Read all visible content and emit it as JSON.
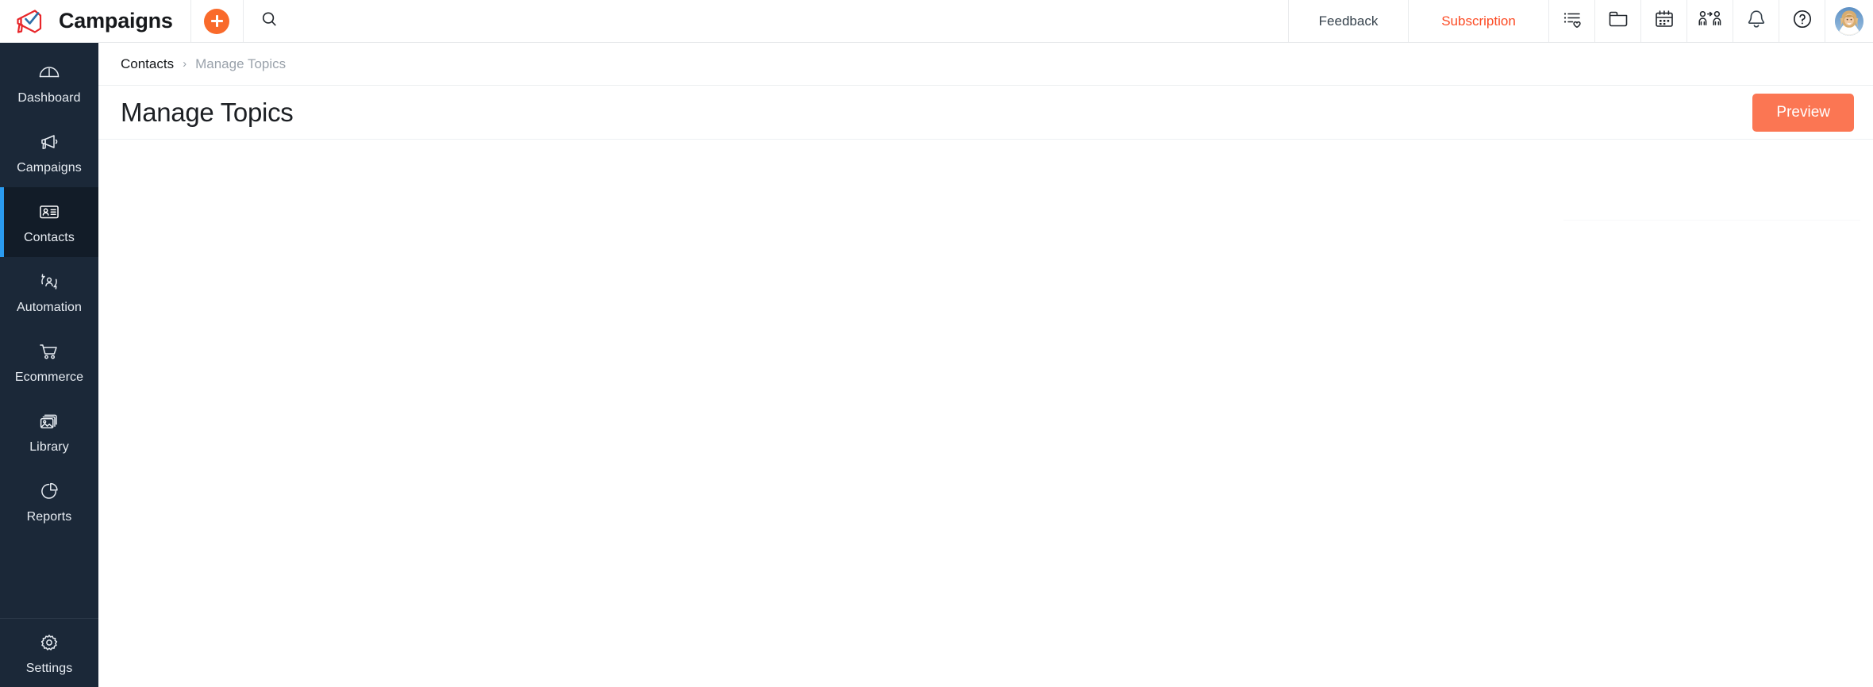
{
  "app": {
    "brand_title": "Campaigns",
    "logo_icon": "megaphone-logo-icon"
  },
  "header": {
    "add_button_icon": "plus-icon",
    "search_icon": "search-icon",
    "feedback_label": "Feedback",
    "subscription_label": "Subscription",
    "subscription_color": "#fc4b24",
    "accent_color": "#f96a2b",
    "icons": [
      {
        "name": "list-heart-icon",
        "title": "Favourite lists"
      },
      {
        "name": "folder-icon",
        "title": "Folders"
      },
      {
        "name": "calendar-icon",
        "title": "Calendar"
      },
      {
        "name": "invite-users-icon",
        "title": "Invite users"
      },
      {
        "name": "bell-icon",
        "title": "Notifications"
      },
      {
        "name": "help-circle-icon",
        "title": "Help"
      }
    ],
    "avatar": {
      "name": "user-avatar",
      "alt": "User profile photo"
    }
  },
  "sidebar": {
    "background": "#1b2838",
    "active_indicator_color": "#2a9bf0",
    "items": [
      {
        "label": "Dashboard",
        "icon": "dashboard-gauge-icon",
        "active": false
      },
      {
        "label": "Campaigns",
        "icon": "megaphone-icon",
        "active": false
      },
      {
        "label": "Contacts",
        "icon": "contact-card-icon",
        "active": true
      },
      {
        "label": "Automation",
        "icon": "automation-user-cycle-icon",
        "active": false
      },
      {
        "label": "Ecommerce",
        "icon": "shopping-cart-icon",
        "active": false
      },
      {
        "label": "Library",
        "icon": "image-library-icon",
        "active": false
      },
      {
        "label": "Reports",
        "icon": "pie-chart-icon",
        "active": false
      }
    ],
    "bottom_items": [
      {
        "label": "Settings",
        "icon": "gear-icon",
        "active": false
      }
    ]
  },
  "breadcrumb": {
    "parent": "Contacts",
    "separator": "›",
    "current": "Manage Topics"
  },
  "page": {
    "title": "Manage Topics",
    "preview_label": "Preview",
    "preview_color": "#fb7653"
  }
}
